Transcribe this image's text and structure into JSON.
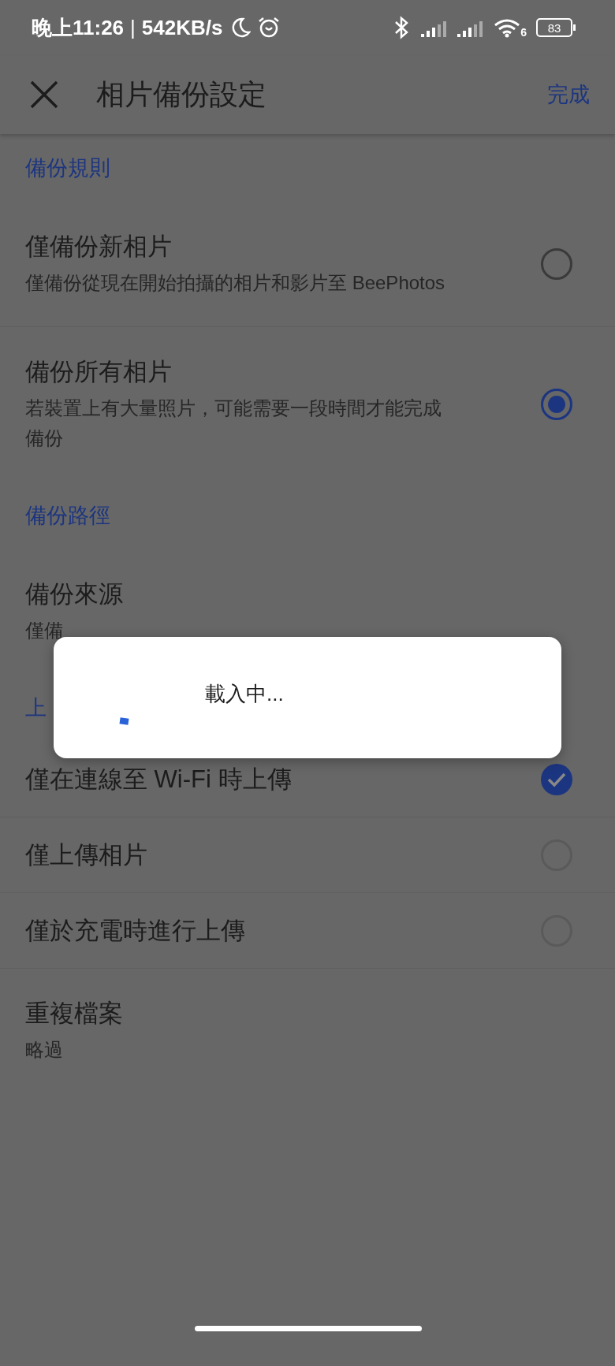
{
  "status_bar": {
    "time": "晚上11:26",
    "separator": "|",
    "speed": "542KB/s",
    "wifi_label": "6",
    "battery": "83"
  },
  "app_bar": {
    "title": "相片備份設定",
    "action": "完成"
  },
  "sections": [
    {
      "header": "備份規則",
      "items": [
        {
          "kind": "radio",
          "title": "僅備份新相片",
          "subtitle": "僅備份從現在開始拍攝的相片和影片至 BeePhotos",
          "selected": false
        },
        {
          "kind": "radio",
          "title": "備份所有相片",
          "subtitle": "若裝置上有大量照片，可能需要一段時間才能完成備份",
          "selected": true
        }
      ]
    },
    {
      "header": "備份路徑",
      "items": [
        {
          "kind": "plain",
          "title": "備份來源",
          "subtitle": "僅備"
        }
      ]
    },
    {
      "header": "上",
      "items": [
        {
          "kind": "checkbox",
          "title": "僅在連線至 Wi-Fi 時上傳",
          "checked": true
        },
        {
          "kind": "checkbox",
          "title": "僅上傳相片",
          "checked": false
        },
        {
          "kind": "checkbox",
          "title": "僅於充電時進行上傳",
          "checked": false
        }
      ]
    },
    {
      "items": [
        {
          "kind": "plain",
          "title": "重複檔案",
          "subtitle": "略過"
        }
      ]
    }
  ],
  "dialog": {
    "message": "載入中..."
  }
}
